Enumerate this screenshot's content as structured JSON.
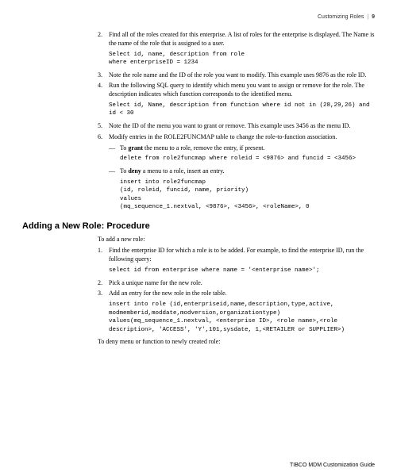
{
  "header": {
    "title": "Customizing Roles",
    "page": "9"
  },
  "steps": [
    {
      "num": "2.",
      "text": "Find all of the roles created for this enterprise. A list of roles for the enterprise is displayed. The Name is the name of the role that is assigned to a user.",
      "code": "Select id, name, description from role\nwhere enterpriseID = 1234"
    },
    {
      "num": "3.",
      "text": "Note the role name and the ID of the role you want to modify. This example uses 9876 as the role ID."
    },
    {
      "num": "4.",
      "text": "Run the following SQL query to identify which menu you want to assign or remove for the role. The description indicates which function corresponds to the identified menu.",
      "code": "Select id, Name, description from function where id not in (28,29,26) and id < 30"
    },
    {
      "num": "5.",
      "text": "Note the ID of the menu you want to grant or remove. This example uses 3456 as the menu ID."
    },
    {
      "num": "6.",
      "text_prefix": "Modify entries in the ",
      "smallcaps": "ROLE2FUNCMAP",
      "text_suffix": " table to change the role-to-function association.",
      "subs": [
        {
          "prefix": "To ",
          "bold": "grant",
          "suffix": " the menu to a role, remove the entry, if present.",
          "code": "delete from role2funcmap where roleid = <9876> and funcid = <3456>"
        },
        {
          "prefix": "To ",
          "bold": "deny",
          "suffix": " a menu to a role, insert an entry.",
          "code": "insert into role2funcmap\n  (id, roleid, funcid, name, priority)\nvalues\n(mq_sequence_1.nextval, <9876>, <3456>, <roleName>, 0"
        }
      ]
    }
  ],
  "section2": {
    "heading": "Adding a New Role: Procedure",
    "intro": "To add a new role:",
    "steps": [
      {
        "num": "1.",
        "text": "Find the enterprise ID for which a role is to be added. For example, to find the enterprise ID, run the following query:",
        "code": "select id from enterprise where name = '<enterprise name>';"
      },
      {
        "num": "2.",
        "text": "Pick a unique name for the new role."
      },
      {
        "num": "3.",
        "text": "Add an entry for the new role in the role table.",
        "code": "insert into role (id,enterpriseid,name,description,type,active, modmemberid,moddate,modversion,organizationtype) values(mq_sequence_1.nextval, <enterprise ID>, <role name>,<role description>, 'ACCESS', 'Y',101,sysdate, 1,<RETAILER or SUPPLIER>)"
      }
    ],
    "closing": "To deny menu or function to newly created role:"
  },
  "footer": "TIBCO MDM Customization Guide"
}
